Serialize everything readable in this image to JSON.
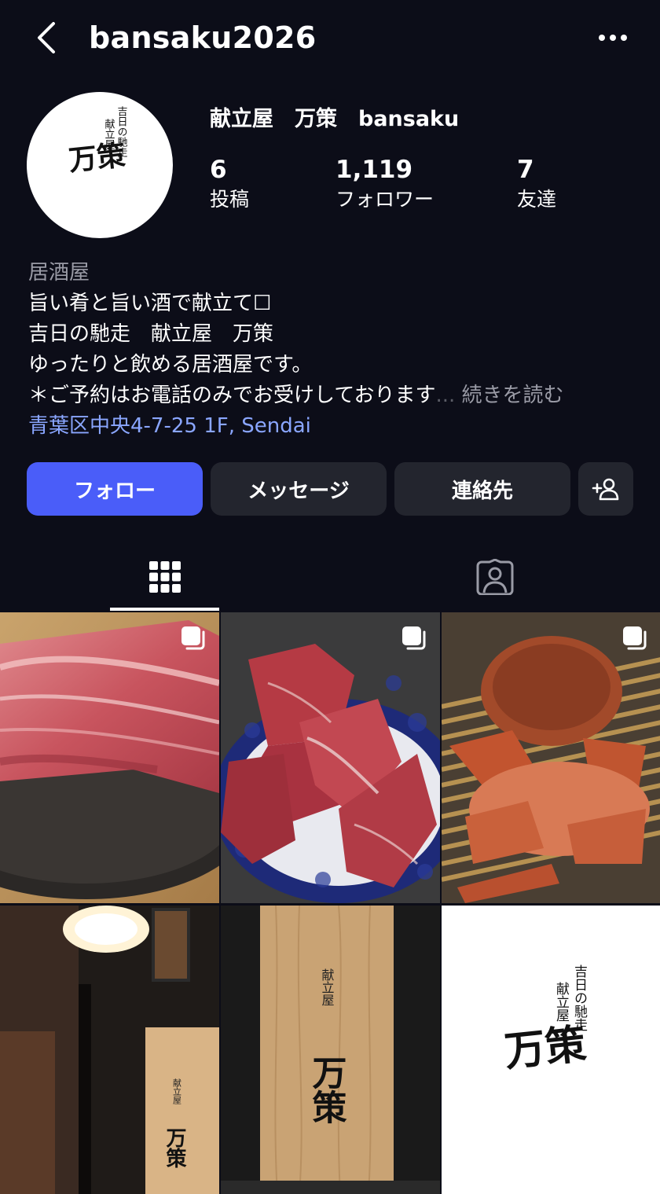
{
  "header": {
    "username": "bansaku2026",
    "back_icon": "chevron-left-icon",
    "more_icon": "ellipsis-horizontal-icon"
  },
  "profile": {
    "display_name": "献立屋　万策　bansaku",
    "avatar_logo": {
      "small_line1": "吉日の馳走",
      "small_line2": "献立屋",
      "main": "万策"
    },
    "stats": [
      {
        "value": "6",
        "label": "投稿"
      },
      {
        "value": "1,119",
        "label": "フォロワー"
      },
      {
        "value": "7",
        "label": "友達"
      }
    ]
  },
  "bio": {
    "category": "居酒屋",
    "lines": [
      "旨い肴と旨い酒で献立て☐",
      "吉日の馳走　献立屋　万策",
      "ゆったりと飲める居酒屋です。",
      "＊ご予約はお電話のみでお受けしております"
    ],
    "ellipsis": "...",
    "read_more": "続きを読む",
    "address": "青葉区中央4-7-25 1F, Sendai"
  },
  "actions": {
    "follow": "フォロー",
    "message": "メッセージ",
    "contact": "連絡先",
    "add_person_icon": "person-add-icon"
  },
  "tabs": [
    {
      "name": "posts-grid",
      "icon": "grid-icon",
      "active": true
    },
    {
      "name": "tagged",
      "icon": "tagged-person-icon",
      "active": false
    }
  ],
  "posts": [
    {
      "subject": "tuna",
      "carousel": true
    },
    {
      "subject": "beef",
      "carousel": true
    },
    {
      "subject": "crab",
      "carousel": true
    },
    {
      "subject": "entrance-sign",
      "carousel": false,
      "sign_small": "献立屋",
      "sign_main": "万策"
    },
    {
      "subject": "wood-sign",
      "carousel": false,
      "sign_small": "献立屋",
      "sign_main": "万策"
    },
    {
      "subject": "logo",
      "carousel": false,
      "logo_line1": "吉日の馳走",
      "logo_line2": "献立屋",
      "logo_main": "万策"
    }
  ],
  "colors": {
    "background": "#0c0d18",
    "follow_button": "#4a5df9",
    "secondary_button": "#23252e",
    "address_link": "#8aa6ff",
    "muted_text": "#9a9ba6"
  }
}
